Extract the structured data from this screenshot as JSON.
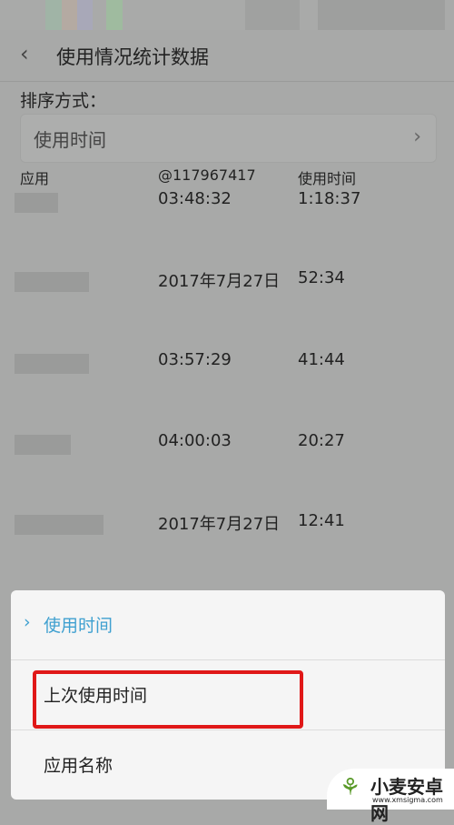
{
  "header": {
    "title": "使用情况统计数据"
  },
  "sort": {
    "label": "排序方式：",
    "value": "使用时间"
  },
  "table": {
    "headers": [
      "应用",
      "@117967417",
      "使用时间"
    ],
    "rows": [
      {
        "last": "03:48:32",
        "time": "1:18:37"
      },
      {
        "last": "2017年7月27日",
        "time": "52:34"
      },
      {
        "last": "03:57:29",
        "time": "41:44"
      },
      {
        "last": "04:00:03",
        "time": "20:27"
      },
      {
        "last": "2017年7月27日",
        "time": "12:41"
      }
    ]
  },
  "popup": {
    "options": [
      "使用时间",
      "上次使用时间",
      "应用名称"
    ],
    "selected": 0,
    "accent": "#3fa0d0",
    "highlight": "#e01818"
  },
  "watermark": {
    "name": "小麦安卓网",
    "url": "www.xmsigma.com"
  }
}
